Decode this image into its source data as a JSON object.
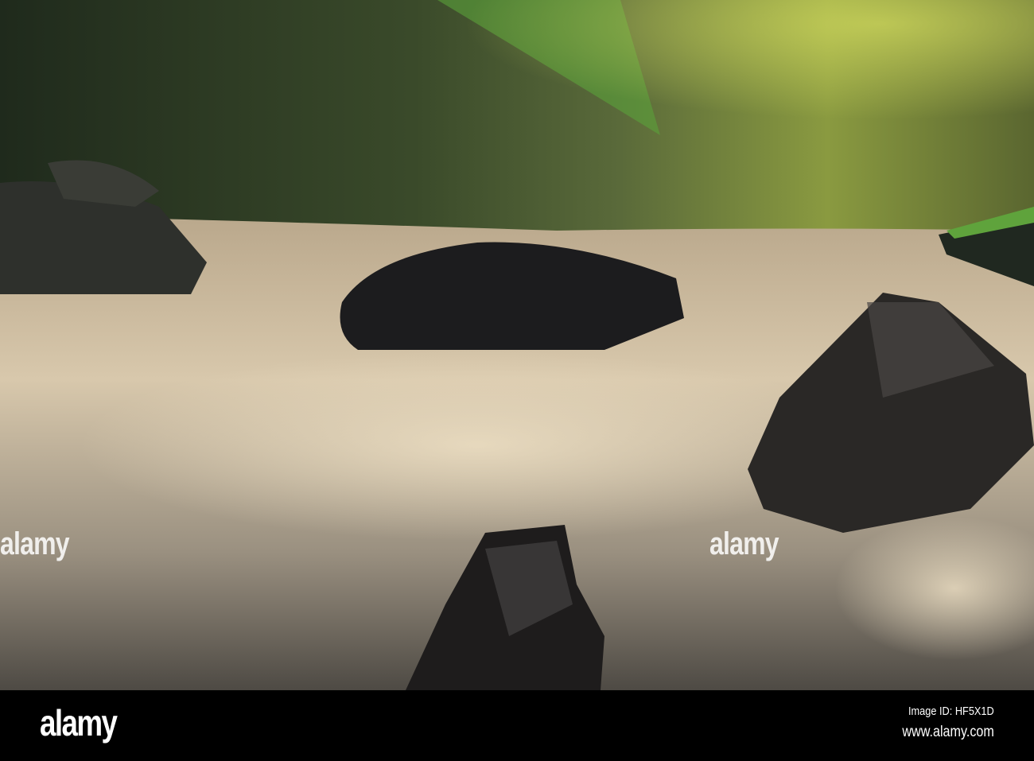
{
  "photo": {
    "description_icon": "river-rapids-photo"
  },
  "watermark": {
    "text": "alamy"
  },
  "footer": {
    "logo": "alamy",
    "image_id": "Image ID: HF5X1D",
    "url": "www.alamy.com"
  }
}
